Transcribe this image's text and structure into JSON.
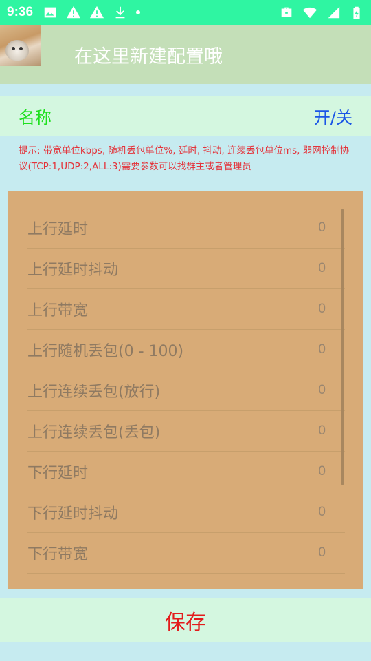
{
  "status_bar": {
    "time": "9:36",
    "left_icons": [
      "image-icon",
      "warning-icon",
      "warning-icon",
      "download-icon",
      "dot-icon"
    ],
    "right_icons": [
      "briefcase-icon",
      "wifi-icon",
      "signal-icon",
      "battery-charging-icon"
    ],
    "color": "#2ff5a2"
  },
  "header": {
    "title": "在这里新建配置哦",
    "background": "#c4dfb8"
  },
  "name_row": {
    "name_label": "名称",
    "toggle_label": "开/关"
  },
  "hint": {
    "text": "提示: 带宽单位kbps, 随机丢包单位%, 延时, 抖动, 连续丢包单位ms, 弱网控制协议(TCP:1,UDP:2,ALL:3)需要参数可以找群主或者管理员"
  },
  "params": [
    {
      "label": "上行延时",
      "value": "0"
    },
    {
      "label": "上行延时抖动",
      "value": "0"
    },
    {
      "label": "上行带宽",
      "value": "0"
    },
    {
      "label": "上行随机丢包(0 - 100)",
      "value": "0"
    },
    {
      "label": "上行连续丢包(放行)",
      "value": "0"
    },
    {
      "label": "上行连续丢包(丢包)",
      "value": "0"
    },
    {
      "label": "下行延时",
      "value": "0"
    },
    {
      "label": "下行延时抖动",
      "value": "0"
    },
    {
      "label": "下行带宽",
      "value": "0"
    }
  ],
  "save_label": "保存"
}
